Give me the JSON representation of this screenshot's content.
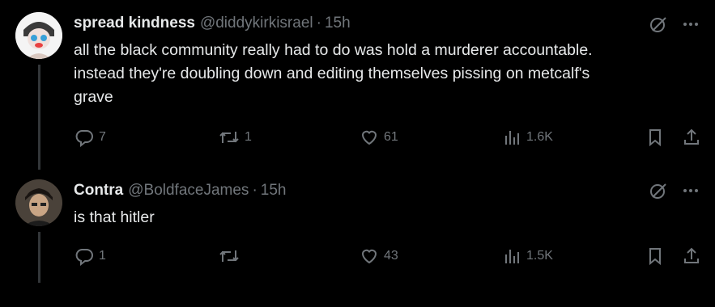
{
  "tweets": [
    {
      "name": "spread kindness",
      "handle": "@diddykirkisrael",
      "separator": "·",
      "time": "15h",
      "text": [
        "all the black community really had to do was hold a murderer accountable.",
        "instead they're doubling down and editing themselves pissing on metcalf's",
        "grave"
      ],
      "replies": "7",
      "reposts": "1",
      "likes": "61",
      "views": "1.6K"
    },
    {
      "name": "Contra",
      "handle": "@BoldfaceJames",
      "separator": "·",
      "time": "15h",
      "text": [
        "is that hitler"
      ],
      "replies": "1",
      "reposts": "",
      "likes": "43",
      "views": "1.5K"
    }
  ],
  "colors": {
    "background": "#000000",
    "text": "#e7e9ea",
    "muted": "#71767b",
    "thread_line": "#333639"
  },
  "icons": [
    "grok-icon",
    "more-icon",
    "reply-icon",
    "repost-icon",
    "like-icon",
    "views-icon",
    "bookmark-icon",
    "share-icon"
  ]
}
